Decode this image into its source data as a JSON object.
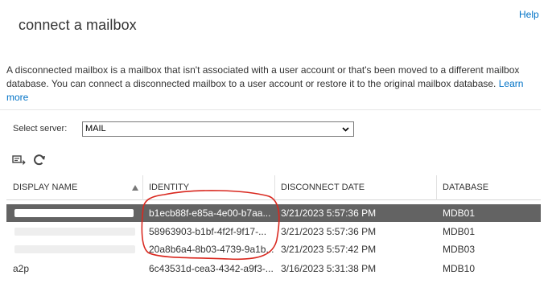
{
  "dialog": {
    "title": "connect a mailbox",
    "help_label": "Help",
    "description": "A disconnected mailbox is a mailbox that isn't associated with a user account or that's been moved to a different mailbox database. You can connect a disconnected mailbox to a user account or restore it to the original mailbox database.",
    "learn_more": "Learn more"
  },
  "server": {
    "label": "Select server:",
    "selected": "MAIL"
  },
  "toolbar": {
    "icons": [
      "connect-mailbox-icon",
      "refresh-icon"
    ]
  },
  "table": {
    "columns": [
      "DISPLAY NAME",
      "IDENTITY",
      "DISCONNECT DATE",
      "DATABASE"
    ],
    "sorted_column": "DISPLAY NAME",
    "rows": [
      {
        "name": "",
        "identity": "b1ecb88f-e85a-4e00-b7aa...",
        "date": "3/21/2023 5:57:36 PM",
        "database": "MDB01",
        "selected": true
      },
      {
        "name": "",
        "identity": "58963903-b1bf-4f2f-9f17-...",
        "date": "3/21/2023 5:57:36 PM",
        "database": "MDB01",
        "selected": false
      },
      {
        "name": "",
        "identity": "20a8b6a4-8b03-4739-9a1b...",
        "date": "3/21/2023 5:57:42 PM",
        "database": "MDB03",
        "selected": false
      },
      {
        "name": "a2p",
        "identity": "6c43531d-cea3-4342-a9f3-...",
        "date": "3/16/2023 5:31:38 PM",
        "database": "MDB10",
        "selected": false
      }
    ]
  },
  "colors": {
    "link": "#0072c6",
    "selected_row": "#636363",
    "annotation": "#d9281f"
  }
}
